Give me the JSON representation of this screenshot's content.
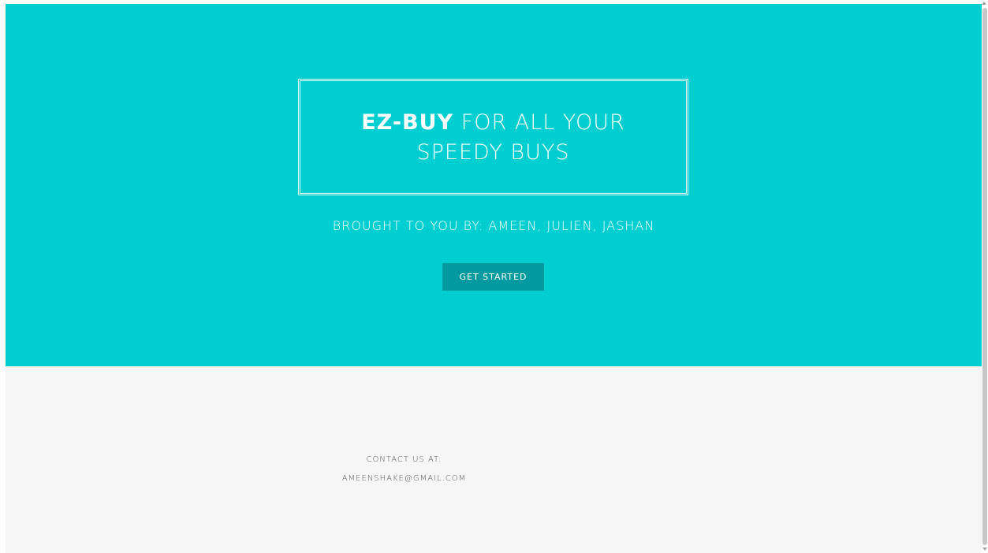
{
  "colors": {
    "hero_background": "#00ced1",
    "button_background": "#009aa0",
    "footer_background": "#f6f6f6"
  },
  "hero": {
    "title_brand": "EZ-BUY",
    "title_rest": "FOR ALL YOUR",
    "title_line2": "SPEEDY BUYS",
    "subtitle": "BROUGHT TO YOU BY: AMEEN, JULIEN, JASHAN",
    "cta_label": "GET STARTED"
  },
  "footer": {
    "contact_label": "CONTACT US AT:",
    "contact_email": "AMEENSHAKE@GMAIL.COM"
  }
}
